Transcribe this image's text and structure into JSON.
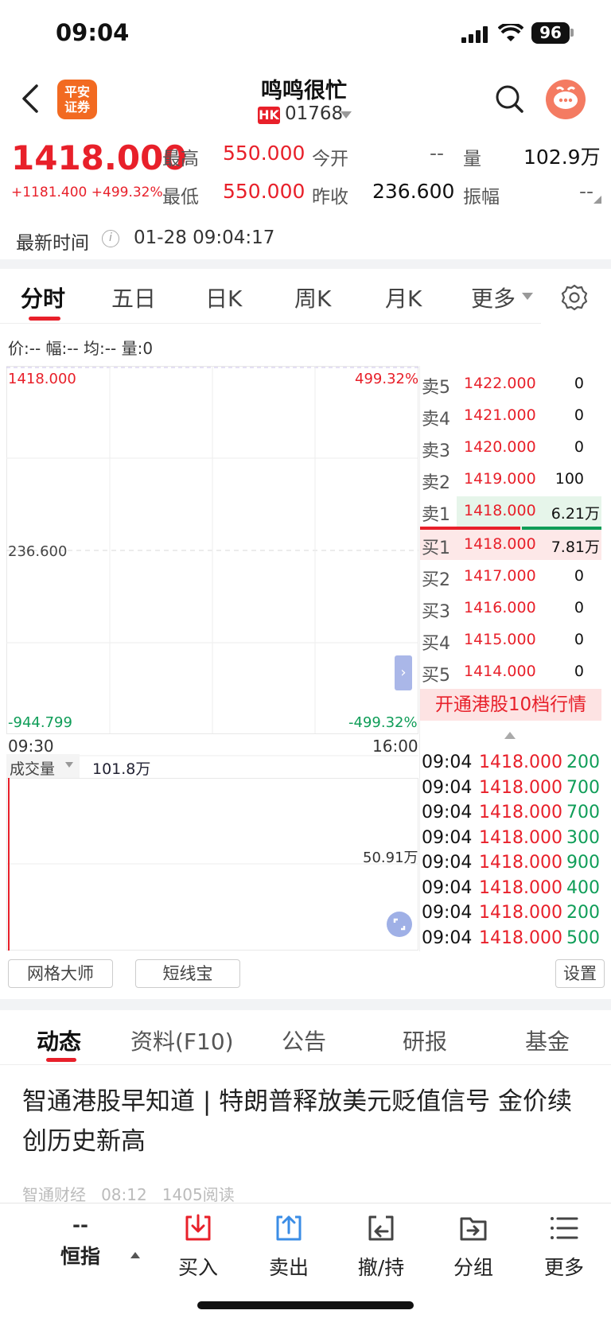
{
  "status_bar": {
    "time": "09:04",
    "battery": "96"
  },
  "header": {
    "logo_text": [
      "平安",
      "证券"
    ],
    "stock_name": "鸣鸣很忙",
    "market_badge": "HK",
    "stock_code": "01768"
  },
  "quote": {
    "price": "1418.000",
    "change": "+1181.400 +499.32%",
    "high_label": "最高",
    "high_value": "550.000",
    "open_label": "今开",
    "open_value": "--",
    "volume_label": "量",
    "volume_value": "102.9万",
    "low_label": "最低",
    "low_value": "550.000",
    "prev_close_label": "昨收",
    "prev_close_value": "236.600",
    "amplitude_label": "振幅",
    "amplitude_value": "--",
    "latest_time_label": "最新时间",
    "latest_time_value": "01-28 09:04:17"
  },
  "chart_tabs": [
    "分时",
    "五日",
    "日K",
    "周K",
    "月K",
    "更多"
  ],
  "info_line": "价:--  幅:--  均:--  量:0",
  "chart": {
    "top_price": "1418.000",
    "mid_price": "236.600",
    "bottom_price": "-944.799",
    "top_pct": "499.32%",
    "bottom_pct": "-499.32%",
    "start_time": "09:30",
    "end_time": "16:00",
    "volume_label": "成交量",
    "volume_value": "101.8万",
    "volume_mid": "50.91万"
  },
  "order_book": {
    "asks": [
      {
        "label": "卖5",
        "price": "1422.000",
        "volume": "0"
      },
      {
        "label": "卖4",
        "price": "1421.000",
        "volume": "0"
      },
      {
        "label": "卖3",
        "price": "1420.000",
        "volume": "0"
      },
      {
        "label": "卖2",
        "price": "1419.000",
        "volume": "100"
      },
      {
        "label": "卖1",
        "price": "1418.000",
        "volume": "6.21万"
      }
    ],
    "bids": [
      {
        "label": "买1",
        "price": "1418.000",
        "volume": "7.81万"
      },
      {
        "label": "买2",
        "price": "1417.000",
        "volume": "0"
      },
      {
        "label": "买3",
        "price": "1416.000",
        "volume": "0"
      },
      {
        "label": "买4",
        "price": "1415.000",
        "volume": "0"
      },
      {
        "label": "买5",
        "price": "1414.000",
        "volume": "0"
      }
    ],
    "hk10_button": "开通港股10档行情"
  },
  "ticks": [
    {
      "time": "09:04",
      "price": "1418.000",
      "volume": "200"
    },
    {
      "time": "09:04",
      "price": "1418.000",
      "volume": "700"
    },
    {
      "time": "09:04",
      "price": "1418.000",
      "volume": "700"
    },
    {
      "time": "09:04",
      "price": "1418.000",
      "volume": "300"
    },
    {
      "time": "09:04",
      "price": "1418.000",
      "volume": "900"
    },
    {
      "time": "09:04",
      "price": "1418.000",
      "volume": "400"
    },
    {
      "time": "09:04",
      "price": "1418.000",
      "volume": "200"
    },
    {
      "time": "09:04",
      "price": "1418.000",
      "volume": "500"
    }
  ],
  "tools": {
    "grid_master": "网格大师",
    "short_term": "短线宝",
    "settings": "设置"
  },
  "news_tabs": [
    "动态",
    "资料(F10)",
    "公告",
    "研报",
    "基金"
  ],
  "news": {
    "title": "智通港股早知道 | 特朗普释放美元贬值信号 金价续创历史新高",
    "source": "智通财经",
    "time": "08:12",
    "reads": "1405阅读"
  },
  "bottom_bar": {
    "index_value": "--",
    "index_label": "恒指",
    "buy": "买入",
    "sell": "卖出",
    "cancel_hold": "撤/持",
    "group": "分组",
    "more": "更多"
  },
  "colors": {
    "up": "#e8202a",
    "down": "#0f9d58",
    "accent": "#f26a21",
    "action_blue": "#3b8de6"
  }
}
